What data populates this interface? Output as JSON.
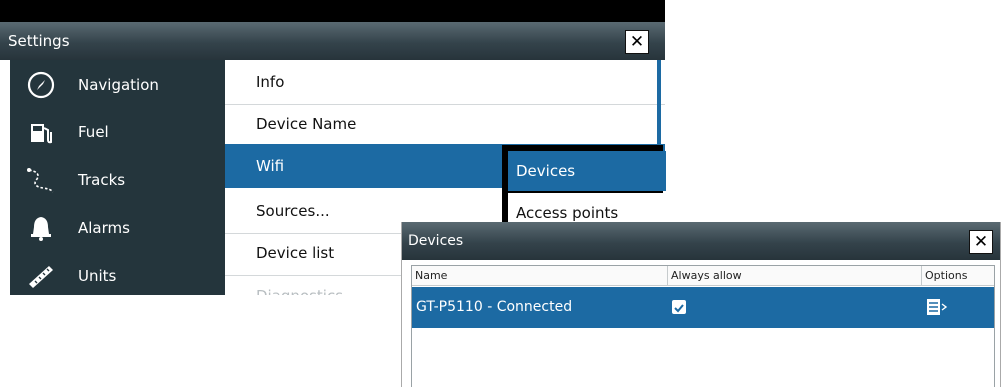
{
  "settings": {
    "title": "Settings",
    "close_label": "✕",
    "sidebar": [
      {
        "label": "Navigation",
        "icon": "compass-icon"
      },
      {
        "label": "Fuel",
        "icon": "fuel-pump-icon"
      },
      {
        "label": "Tracks",
        "icon": "tracks-icon"
      },
      {
        "label": "Alarms",
        "icon": "bell-icon"
      },
      {
        "label": "Units",
        "icon": "ruler-icon"
      }
    ],
    "menu": [
      {
        "label": "Info"
      },
      {
        "label": "Device Name"
      },
      {
        "label": "Wifi",
        "selected": true
      },
      {
        "label": "Sources..."
      },
      {
        "label": "Device list"
      },
      {
        "label": "Diagnostics"
      }
    ],
    "wifi_popup": [
      {
        "label": "Devices",
        "selected": true
      },
      {
        "label": "Access points"
      }
    ]
  },
  "devices_dialog": {
    "title": "Devices",
    "close_label": "✕",
    "columns": [
      "Name",
      "Always allow",
      "Options"
    ],
    "rows": [
      {
        "name": "GT-P5110 - Connected",
        "always_allow": true,
        "options_icon": "options-menu-icon"
      }
    ]
  },
  "colors": {
    "selection_blue": "#1c6aa3",
    "sidebar_bg": "#24353c",
    "titlebar_bg": "#34434b"
  }
}
